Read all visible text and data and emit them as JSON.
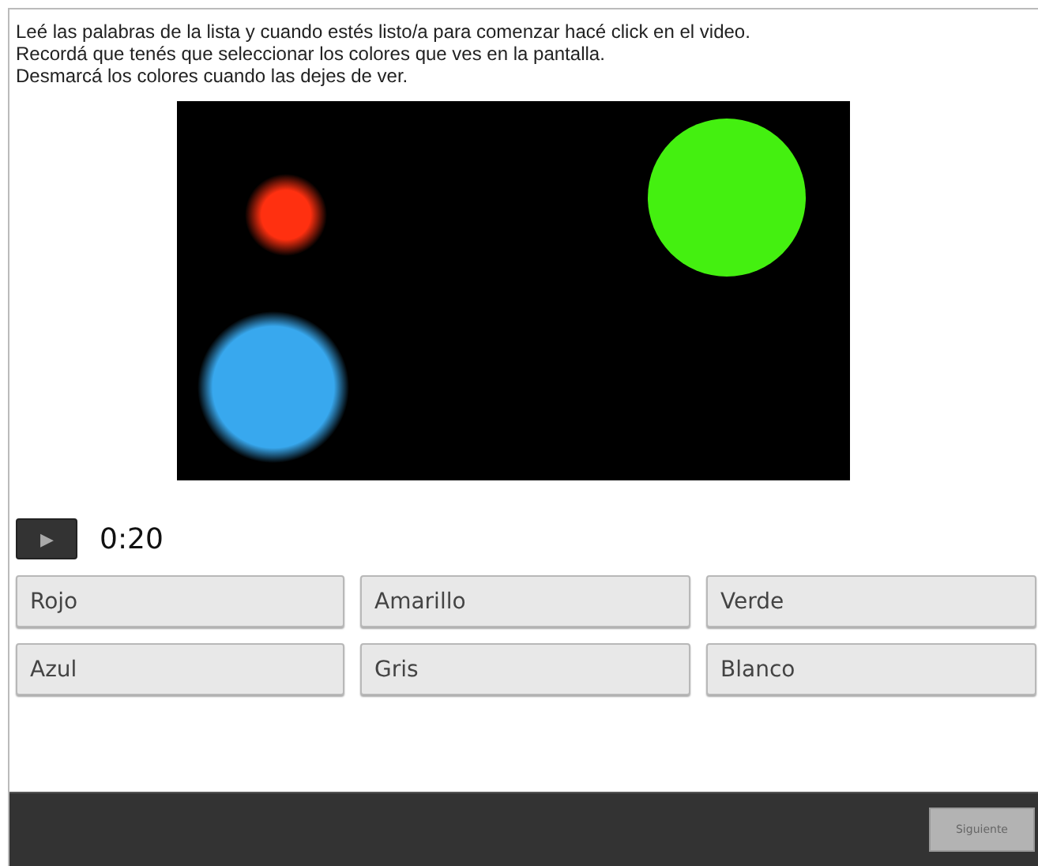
{
  "instructions": [
    "Leé las palabras de la lista y cuando estés listo/a para comenzar hacé click en el video.",
    "Recordá que tenés que seleccionar los colores que ves en la pantalla.",
    "Desmarcá los colores cuando las dejes de ver."
  ],
  "player": {
    "play_icon": "▶",
    "time": "0:20"
  },
  "options": [
    {
      "label": "Rojo",
      "selected": false
    },
    {
      "label": "Amarillo",
      "selected": false
    },
    {
      "label": "Verde",
      "selected": false
    },
    {
      "label": "Azul",
      "selected": false
    },
    {
      "label": "Gris",
      "selected": false
    },
    {
      "label": "Blanco",
      "selected": false
    }
  ],
  "footer": {
    "button": "Siguiente"
  }
}
